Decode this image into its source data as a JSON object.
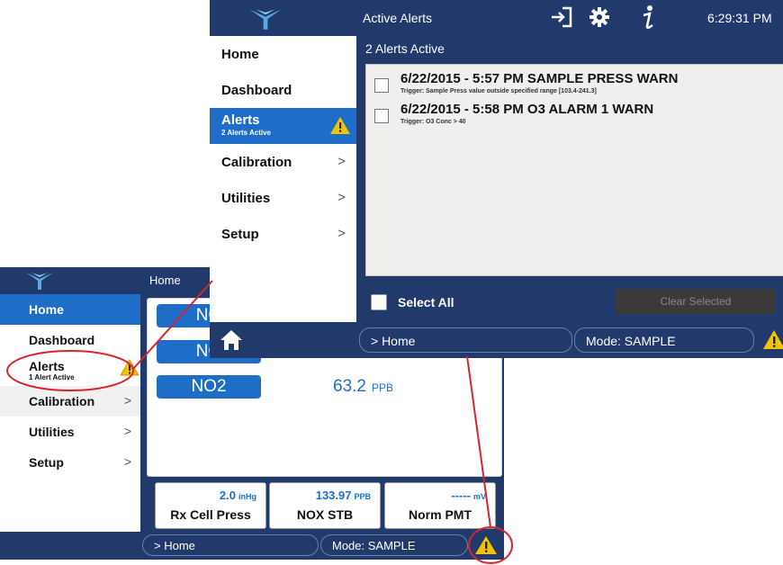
{
  "home_screen": {
    "title": "Home",
    "menu": [
      {
        "label": "Home"
      },
      {
        "label": "Dashboard"
      },
      {
        "label": "Alerts",
        "sub": "1 Alert Active"
      },
      {
        "label": "Calibration",
        "chevron": ">"
      },
      {
        "label": "Utilities",
        "chevron": ">"
      },
      {
        "label": "Setup",
        "chevron": ">"
      }
    ],
    "gases": [
      {
        "label": "NO",
        "value": ""
      },
      {
        "label": "NO",
        "value": ""
      },
      {
        "label": "NO2",
        "value": "63.2",
        "unit": "PPB"
      }
    ],
    "meters": [
      {
        "value": "2.0",
        "unit": "inHg",
        "name": "Rx Cell Press"
      },
      {
        "value": "133.97",
        "unit": "PPB",
        "name": "NOX STB"
      },
      {
        "value": "-----",
        "unit": "mV",
        "name": "Norm PMT"
      }
    ],
    "breadcrumb": "> Home",
    "mode": "Mode: SAMPLE"
  },
  "alerts_screen": {
    "title": "Active Alerts",
    "time": "6:29:31 PM",
    "menu": [
      {
        "label": "Home"
      },
      {
        "label": "Dashboard"
      },
      {
        "label": "Alerts",
        "sub": "2 Alerts Active"
      },
      {
        "label": "Calibration",
        "chevron": ">"
      },
      {
        "label": "Utilities",
        "chevron": ">"
      },
      {
        "label": "Setup",
        "chevron": ">"
      }
    ],
    "count_text": "2 Alerts Active",
    "alerts": [
      {
        "title": "6/22/2015 - 5:57 PM SAMPLE PRESS WARN",
        "trigger": "Trigger: Sample Press value outside specified range [103.4-241.3]"
      },
      {
        "title": "6/22/2015 - 5:58 PM O3 ALARM 1 WARN",
        "trigger": "Trigger: O3 Conc > 40"
      }
    ],
    "select_all": "Select All",
    "clear_selected": "Clear Selected",
    "breadcrumb": "> Home",
    "mode": "Mode: SAMPLE"
  },
  "colors": {
    "navy": "#213a6b",
    "accent_blue": "#1e6ec8",
    "warning_yellow": "#f2c300",
    "annotation_red": "#d8242b"
  },
  "icons": [
    "teledyne-logo-icon",
    "logout-icon",
    "gear-icon",
    "info-icon",
    "home-icon",
    "warning-icon",
    "chevron-right-icon"
  ]
}
